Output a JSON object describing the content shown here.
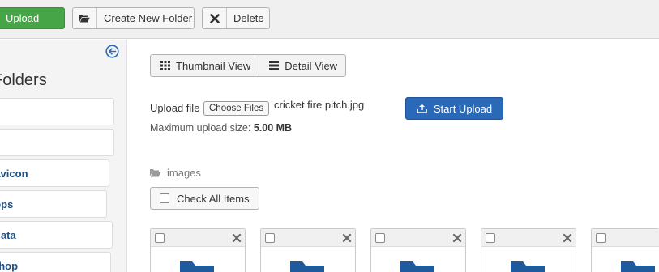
{
  "toolbar": {
    "upload_label": "Upload",
    "new_folder_label": "Create New Folder",
    "delete_label": "Delete"
  },
  "sidebar": {
    "title": "Folders",
    "items": [
      {
        "label": ""
      },
      {
        "label": ""
      },
      {
        "label": "favicon"
      },
      {
        "label": "apps"
      },
      {
        "label": "data"
      },
      {
        "label": "shop"
      }
    ]
  },
  "views": {
    "thumbnail_label": "Thumbnail View",
    "detail_label": "Detail View"
  },
  "upload": {
    "label": "Upload file",
    "choose_label": "Choose Files",
    "chosen_file": "cricket fire pitch.jpg",
    "max_size_label": "Maximum upload size:",
    "max_size_value": "5.00 MB",
    "start_label": "Start Upload"
  },
  "breadcrumb": {
    "folder": "images"
  },
  "check_all_label": "Check All Items",
  "colors": {
    "upload_green": "#46a546",
    "primary_blue": "#2a69b8",
    "folder_blue": "#1e5a9c",
    "link_blue": "#205081"
  }
}
